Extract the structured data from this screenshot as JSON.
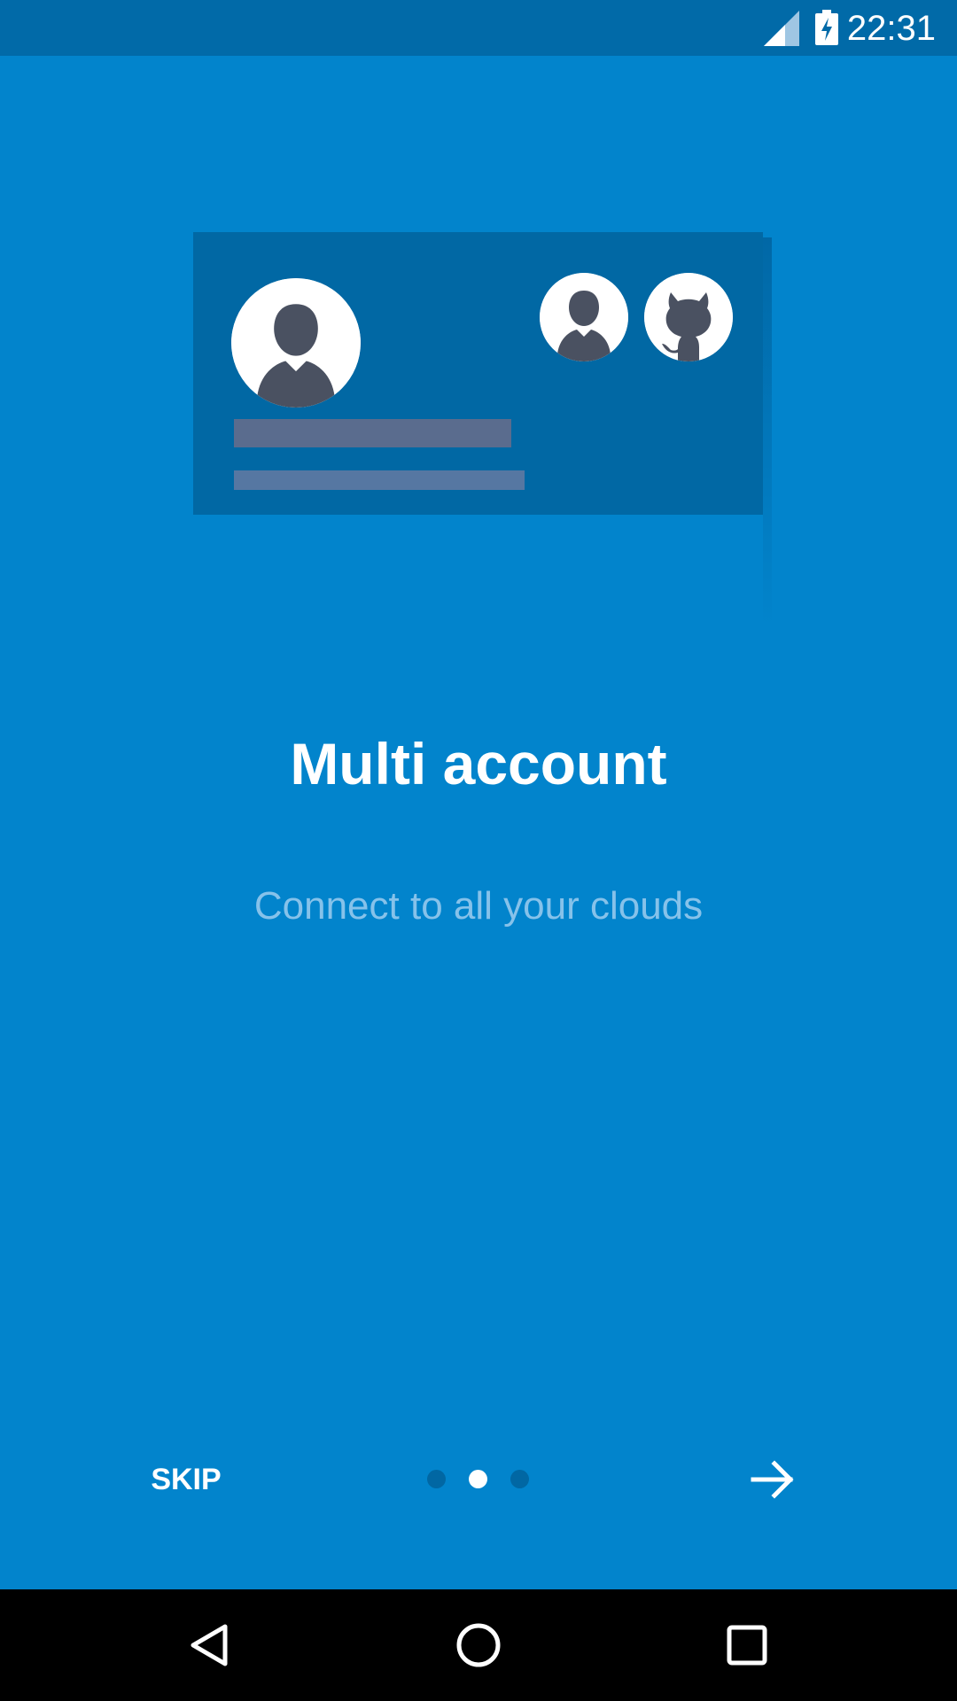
{
  "status_bar": {
    "time": "22:31",
    "signal_icon": "cell-signal-icon",
    "battery_icon": "battery-charging-icon"
  },
  "illustration": {
    "main_avatar_icon": "person-silhouette-icon",
    "account_icons": [
      "person-silhouette-icon",
      "github-octocat-icon"
    ]
  },
  "onboarding": {
    "title": "Multi account",
    "subtitle": "Connect to all your clouds",
    "current_page": 2,
    "total_pages": 3
  },
  "controls": {
    "skip_label": "SKIP",
    "next_icon": "arrow-right-icon"
  },
  "nav_bar": {
    "back_icon": "back-triangle-icon",
    "home_icon": "home-circle-icon",
    "recents_icon": "recents-square-icon"
  },
  "colors": {
    "background": "#0284CC",
    "status_bar": "#016AA8",
    "card": "#0168A4",
    "subtitle": "#86C2EA",
    "inactive_dot": "#0167A3"
  }
}
